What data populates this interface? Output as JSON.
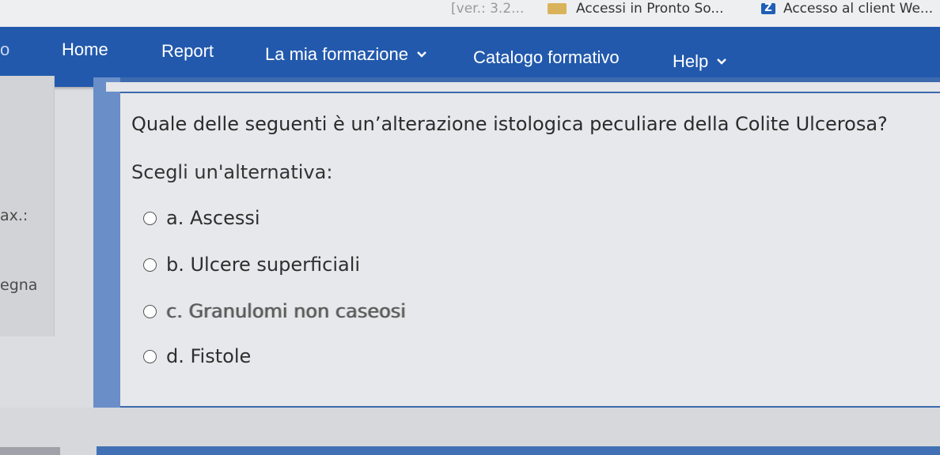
{
  "bookmarks": {
    "items": [
      {
        "label": "Accessi in Pronto So...",
        "icon": "folder-icon"
      },
      {
        "label": "Accesso al client We...",
        "icon": "z-logo-icon",
        "icon_text": "Z"
      }
    ],
    "faded_label": "[ver.: 3.2..."
  },
  "navbar": {
    "partial_left": "o",
    "items": [
      {
        "label": "Home",
        "dropdown": false
      },
      {
        "label": "Report",
        "dropdown": false
      },
      {
        "label": "La mia formazione",
        "dropdown": true
      },
      {
        "label": "Catalogo formativo",
        "dropdown": false
      },
      {
        "label": "Help",
        "dropdown": true
      }
    ]
  },
  "sidebar": {
    "label_1": "ax.:",
    "label_2": "egna"
  },
  "quiz": {
    "question": "Quale delle seguenti è un’alterazione istologica peculiare della Colite Ulcerosa?",
    "instruction": "Scegli un'alternativa:",
    "answers": [
      {
        "label": "a. Ascessi"
      },
      {
        "label": "b. Ulcere superficiali"
      },
      {
        "label": "c. Granulomi non caseosi"
      },
      {
        "label": "d. Fistole"
      }
    ]
  },
  "colors": {
    "navbar": "#2259ad",
    "card_border": "#3c6aae",
    "card_background": "#e7e8eb"
  }
}
